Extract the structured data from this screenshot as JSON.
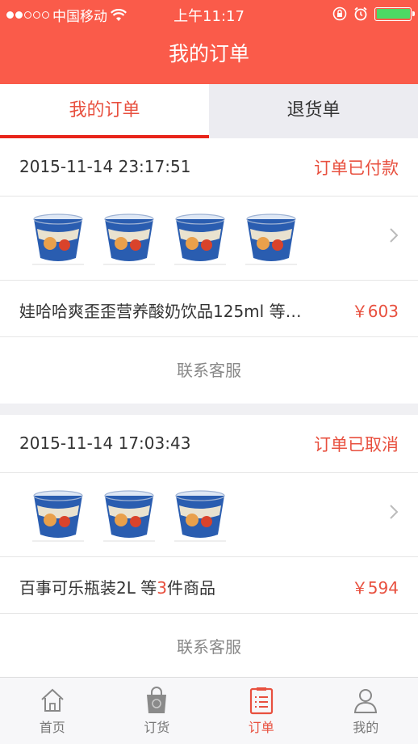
{
  "status_bar": {
    "carrier": "中国移动",
    "time": "上午11:17",
    "colors": {
      "battery_fill": "#4cd964"
    }
  },
  "nav": {
    "title": "我的订单"
  },
  "tabs": [
    {
      "label": "我的订单",
      "active": true
    },
    {
      "label": "退货单",
      "active": false
    }
  ],
  "orders": [
    {
      "date": "2015-11-14 23:17:51",
      "status": "订单已付款",
      "thumb_count": 4,
      "summary": "娃哈哈爽歪歪营养酸奶饮品125ml 等…",
      "price": "￥603",
      "service": "联系客服"
    },
    {
      "date": "2015-11-14 17:03:43",
      "status": "订单已取消",
      "thumb_count": 3,
      "summary_prefix": "百事可乐瓶装2L 等",
      "summary_count": "3",
      "summary_suffix": "件商品",
      "price": "￥594",
      "service": "联系客服"
    }
  ],
  "tabbar": [
    {
      "label": "首页",
      "icon": "home-icon",
      "active": false
    },
    {
      "label": "订货",
      "icon": "shopping-bag-icon",
      "active": false
    },
    {
      "label": "订单",
      "icon": "order-list-icon",
      "active": true
    },
    {
      "label": "我的",
      "icon": "user-icon",
      "active": false
    }
  ],
  "colors": {
    "accent": "#fa5b4a",
    "price": "#e8503f"
  }
}
